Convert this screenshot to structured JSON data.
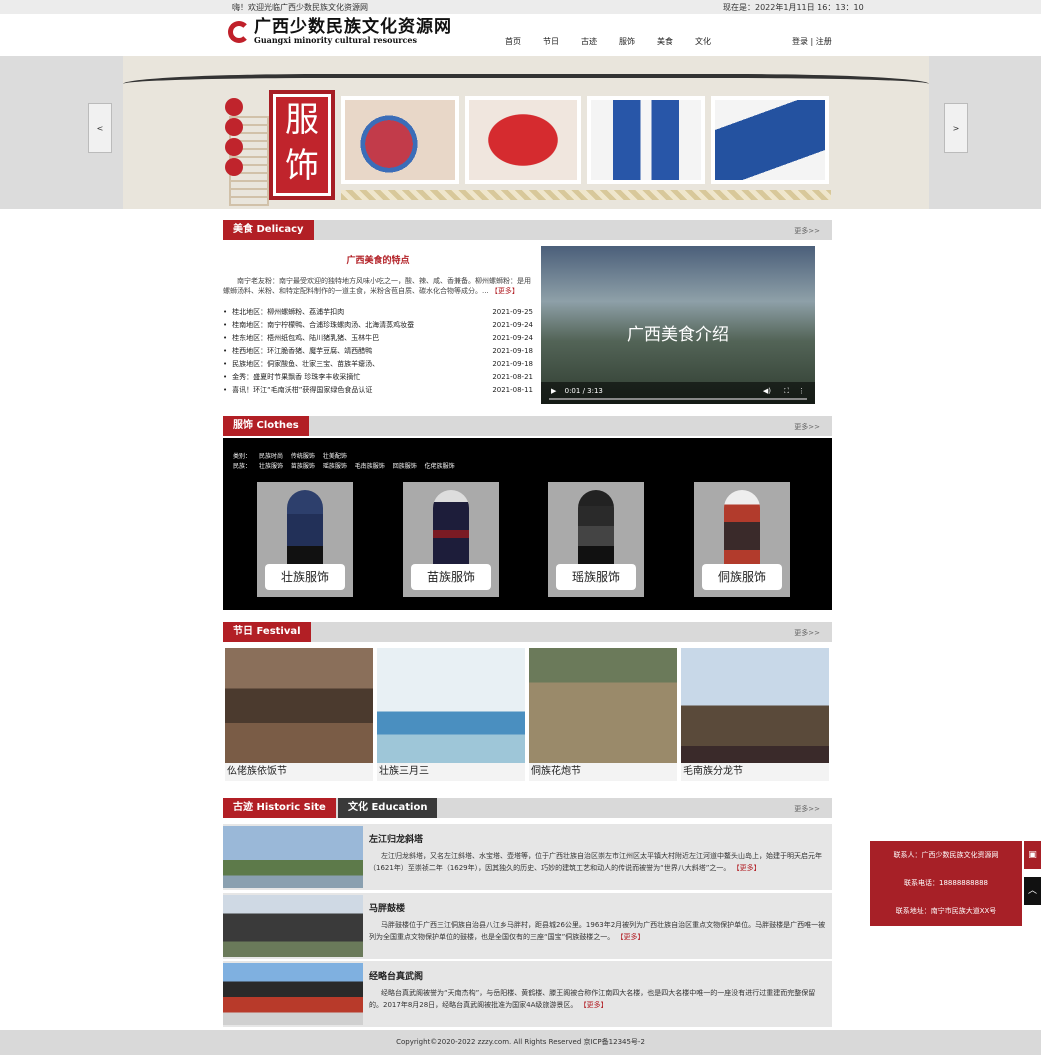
{
  "topbar": {
    "welcome": "嗨！欢迎光临广西少数民族文化资源网",
    "clock": "现在是：2022年1月11日 16：13：10"
  },
  "logo": {
    "cn": "广西少数民族文化资源网",
    "en": "Guangxi minority cultural resources"
  },
  "nav": [
    "首页",
    "节日",
    "古迹",
    "服饰",
    "美食",
    "文化"
  ],
  "login": "登录 | 注册",
  "banner": {
    "title": "服饰",
    "prev": "<",
    "next": ">"
  },
  "food": {
    "tag": "美食 Delicacy",
    "more": "更多>>",
    "title": "广西美食的特点",
    "desc": "南宁老友粉：南宁最受欢迎的独特地方风味小吃之一，酸、辣、咸、香兼备。柳州螺蛳粉：是用螺蛳汤料、米粉、和特定配料制作的一道主食，米粉含苞自质、碳水化合物等成分。...",
    "desc_more": "【更多】",
    "list": [
      {
        "t": "桂北地区：柳州螺蛳粉、荔浦芋扣肉",
        "d": "2021-09-25"
      },
      {
        "t": "桂南地区：南宁柠檬鸭、合浦珍珠螺肉汤、北海清蒸鸡妆蚕",
        "d": "2021-09-24"
      },
      {
        "t": "桂东地区：梧州纸包鸡、陆川猪乳猪、玉林牛巴",
        "d": "2021-09-24"
      },
      {
        "t": "桂西地区：环江脆香猪、魔芋豆腐、靖西醋鸭",
        "d": "2021-09-18"
      },
      {
        "t": "民族地区：侗家酸鱼、壮家三宝、苗族羊瘪汤、",
        "d": "2021-09-18"
      },
      {
        "t": "金秀：盛夏时节果飘香 珍珠李丰收采摘忙",
        "d": "2021-08-21"
      },
      {
        "t": "喜讯！环江“毛南沃柑”获得国家绿色食品认证",
        "d": "2021-08-11"
      }
    ],
    "video": {
      "title": "广西美食介绍",
      "time": "0:01 / 3:13"
    }
  },
  "clothes": {
    "tag": "服饰 Clothes",
    "more": "更多>>",
    "cat_label": "类别：",
    "cats": [
      "民族时尚",
      "传统服饰",
      "壮美配饰"
    ],
    "eth_label": "民族：",
    "eths": [
      "壮族服饰",
      "苗族服饰",
      "瑶族服饰",
      "毛南族服饰",
      "回族服饰",
      "仡佬族服饰"
    ],
    "items": [
      "壮族服饰",
      "苗族服饰",
      "瑶族服饰",
      "侗族服饰"
    ]
  },
  "festival": {
    "tag": "节日 Festival",
    "more": "更多>>",
    "items": [
      "仫佬族依饭节",
      "壮族三月三",
      "侗族花炮节",
      "毛南族分龙节"
    ]
  },
  "sites": {
    "tag": "古迹 Historic Site",
    "tag2": "文化 Education",
    "more": "更多>>",
    "items": [
      {
        "name": "左江归龙斜塔",
        "txt": "左江归龙斜塔，又名左江斜塔、水宝塔、壶塔等，位于广西壮族自治区崇左市江州区太平镇大村附近左江河道中鳌头山岛上，始建于明天启元年（1621年）至崇祯二年（1629年），因其独久的历史、巧妙的建筑工艺和动人的传说而被誉为“世界八大斜塔”之一。",
        "more": "【更多】"
      },
      {
        "name": "马胖鼓楼",
        "txt": "马胖鼓楼位于广西三江侗族自治县八江乡马胖村，距县城26公里。1963年2月被列为广西壮族自治区重点文物保护单位。马胖鼓楼是广西唯一被列为全国重点文物保护单位的鼓楼，也是全国仅有的三座“国宝”侗族鼓楼之一。",
        "more": "【更多】"
      },
      {
        "name": "经略台真武阁",
        "txt": "经略台真武阁被誉为“天南杰构”，与岳阳楼、黄鹤楼、滕王阁被合称作江南四大名楼，也是四大名楼中唯一的一座没有进行过重建而完整保留的。2017年8月28日，经略台真武阁被批准为国家4A级旅游景区。",
        "more": "【更多】"
      }
    ]
  },
  "contact": {
    "person": "联系人：广西少数民族文化资源网",
    "phone": "联系电话：18888888888",
    "address": "联系地址：南宁市民族大道XX号"
  },
  "footer": "Copyright©2020-2022 zzzy.com. All Rights Reserved 京ICP备12345号-2"
}
